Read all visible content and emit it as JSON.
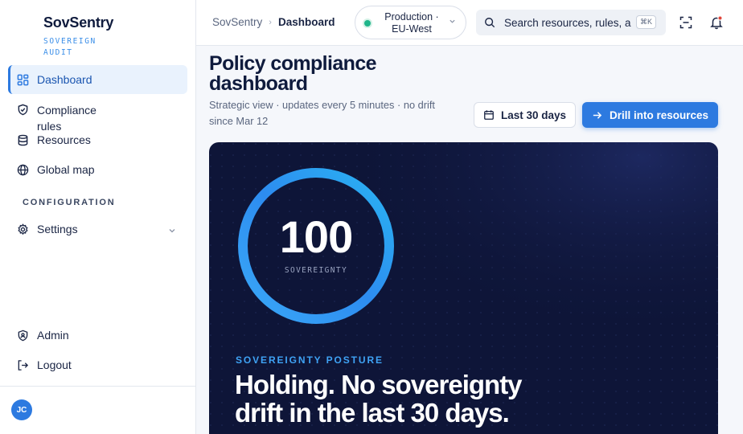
{
  "app": {
    "brand_name": "SovSentry",
    "brand_sub": "SOVEREIGN AUDIT"
  },
  "sidebar": {
    "items": [
      {
        "label": "Dashboard",
        "icon": "grid-icon",
        "active": true
      },
      {
        "label": "Compliance rules",
        "icon": "shield-check-icon",
        "active": false
      },
      {
        "label": "Resources",
        "icon": "database-icon",
        "active": false
      },
      {
        "label": "Global map",
        "icon": "globe-icon",
        "active": false
      }
    ],
    "section_label": "CONFIGURATION",
    "settings_label": "Settings",
    "admin_label": "Admin",
    "logout_label": "Logout",
    "avatar_initials": "JC"
  },
  "topbar": {
    "breadcrumb_root": "SovSentry",
    "breadcrumb_current": "Dashboard",
    "environment": "Production · EU-West",
    "search_placeholder": "Search resources, rules, a",
    "search_shortcut": "⌘K"
  },
  "header": {
    "title": "Policy compliance dashboard",
    "subtitle": "Strategic view · updates every 5 minutes · no drift since Mar 12",
    "range_button": "Last 30 days",
    "drill_button": "Drill into resources"
  },
  "hero": {
    "score": "100",
    "score_fraction": 1.0,
    "score_label": "SOVEREIGNTY",
    "posture_label": "SOVEREIGNTY POSTURE",
    "headline": "Holding. No sovereignty drift in the last 30 days."
  },
  "colors": {
    "accent": "#2d7ae0",
    "hero_bg": "#0e1538",
    "status_green": "#1fb58a"
  }
}
